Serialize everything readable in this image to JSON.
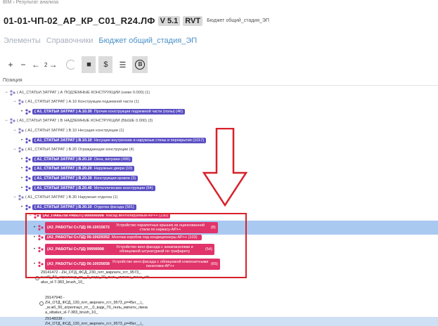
{
  "breadcrumb": "BIM › Результат анализа",
  "header": {
    "title": "01-01-ЧП-02_АР_КР_С01_R24.ЛФ",
    "version": "V 5.1",
    "format": "RVT",
    "subtitle": "Бюджет общий_стадия_ЭП"
  },
  "tabs": [
    {
      "label": "Элементы"
    },
    {
      "label": "Справочники"
    },
    {
      "label": "Бюджет общий_стадия_ЭП"
    }
  ],
  "toolbar": {
    "plus": "+",
    "minus": "−",
    "level": "2",
    "stop": "■",
    "money": "$",
    "list": "☰",
    "b": "B"
  },
  "column_header": "Позиция",
  "tree": [
    {
      "indent": 0,
      "kind": "grp",
      "prefix": "( А1_СТАТЬИ ЗАТРАТ ) А",
      "text": "ПОДЗЕМНЫЕ КОНСТРУКЦИИ (ниже 0.000) (1)"
    },
    {
      "indent": 1,
      "kind": "grp",
      "prefix": "( А1_СТАТЬИ ЗАТРАТ ) А.10",
      "text": "Конструкции подземной части (1)"
    },
    {
      "indent": 2,
      "kind": "chip",
      "code": "( А1_СТАТЬИ ЗАТРАТ ) А.10.30",
      "desc": "Прочие конструкции подземной части (полы) (46)"
    },
    {
      "indent": 0,
      "kind": "grp",
      "prefix": "( А1_СТАТЬИ ЗАТРАТ ) В",
      "text": "НАДЗЕМНЫЕ КОНСТРУКЦИИ (ВЫШЕ 0.000) (3)"
    },
    {
      "indent": 1,
      "kind": "grp",
      "prefix": "( А1_СТАТЬИ ЗАТРАТ ) В.10",
      "text": "Несущие конструкции (1)"
    },
    {
      "indent": 2,
      "kind": "chip",
      "code": "( А1_СТАТЬИ ЗАТРАТ ) В.10.10",
      "desc": "Несущие внутренние и наружные стены и перекрытия (1017)"
    },
    {
      "indent": 1,
      "kind": "grp",
      "prefix": "( А1_СТАТЬИ ЗАТРАТ ) В.20",
      "text": "Ограждающие конструкции (4)"
    },
    {
      "indent": 2,
      "kind": "chip",
      "code": "( А1_СТАТЬИ ЗАТРАТ ) В.20.10",
      "desc": "Окна, витражи (496)"
    },
    {
      "indent": 2,
      "kind": "chip",
      "code": "( А1_СТАТЬИ ЗАТРАТ ) В.20.20",
      "desc": "Наружные двери (10)"
    },
    {
      "indent": 2,
      "kind": "chip",
      "code": "( А1_СТАТЬИ ЗАТРАТ ) В.20.30",
      "desc": "Конструкции кровли (3)"
    },
    {
      "indent": 2,
      "kind": "chip",
      "code": "( А1_СТАТЬИ ЗАТРАТ ) В.20.40",
      "desc": "Металлические конструкции (64)"
    },
    {
      "indent": 1,
      "kind": "grp",
      "prefix": "( А1_СТАТЬИ ЗАТРАТ ) В.30",
      "text": "Наружная отделка (1)"
    },
    {
      "indent": 2,
      "kind": "chip",
      "code": "( А1_СТАТЬИ ЗАТРАТ ) В.30.10",
      "desc": "Отделка фасада (581)"
    }
  ],
  "subtree": {
    "package": {
      "code": "(А2_ПАКЕТЫ РАБОТ) 000000008",
      "desc": "Фасад вентилируемый-АР++ (230)"
    },
    "works": [
      {
        "code": "(А3_РАБОТЫ Ст.ПД) 06-10015672",
        "desc": "Устройство парапетных крышек из оцинкованной стали по каркасу-АР++",
        "count": "(8)"
      },
      {
        "code": "(А3_РАБОТЫ Ст.ПД) 06-10029352",
        "desc": "Монтаж коробов под кондиционеры-АР++ (103)",
        "count": ""
      },
      {
        "code": "(А3_РАБОТЫ Ст.ПД) 99999998",
        "desc": "Устройство вент.фасада с анкапанелями и облицовкой штукатуркой по трафарету",
        "count": "(54)"
      },
      {
        "code": "(А3_РАБОТЫ Ст.ПД) 06-10035658",
        "desc": "Устройство вент.фасада с облицовкой композитными панелями-АР++",
        "count": "(65)"
      }
    ],
    "items": [
      {
        "id": "29141472 - ZH_ОТД_ФСД_230_плт_мкрлатн_гст_9573_",
        "line2": "м.жб|_50_атрелгацт_пт__0_вздк_70_лнль_кмпатн_лмна_sib",
        "line3": "alux_sl-7-383_brush_10_"
      },
      {
        "id": "29147940 -",
        "line2": "ZH_ОТД_ФСД_130_плт_мкрлатн_гст_9573_р=45кг__i_",
        "line3": "_м.жб_50_атрелгацт_пт__0_вздк_70_лнль_кмпатн_лмна",
        "line4": "a_sibalux_sl-7-383_brush_10_"
      },
      {
        "id": "29148338 -",
        "line2": "ZH_ОТД_ФСД_130_плт_мкрлатн_гст_9573_р=45кг__i_"
      }
    ]
  },
  "colors": {
    "chip_purple": "#5b4fc4",
    "chip_pink": "#e0346a",
    "selection": "#a9c9f1",
    "annotation_red": "#d8202a",
    "active_tab": "#4a90c8"
  }
}
